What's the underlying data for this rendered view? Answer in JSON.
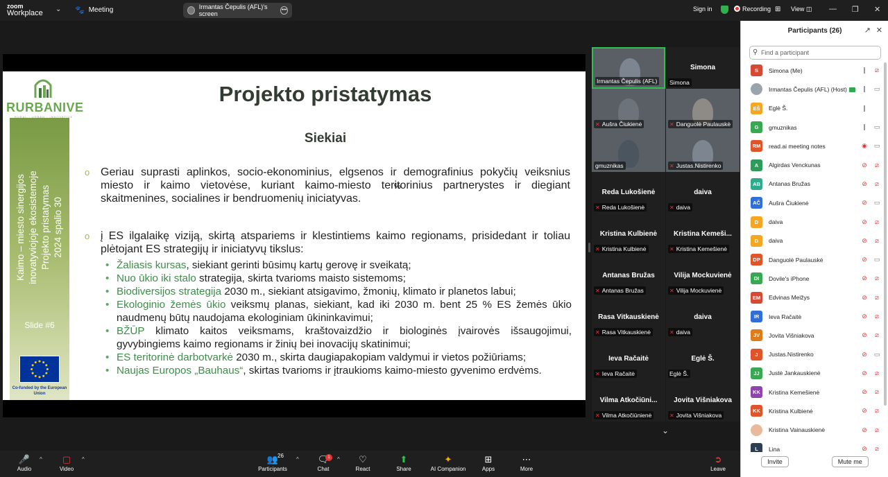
{
  "topbar": {
    "brand_line1": "zoom",
    "brand_line2": "Workplace",
    "meeting_label": "Meeting",
    "screen_share_label": "Irmantas Čepulis (AFL)'s screen",
    "signin": "Sign in",
    "recording": "Recording",
    "view": "View"
  },
  "slide": {
    "title": "Projekto pristatymas",
    "subtitle": "Siekiai",
    "logo_word": "RURBANIVE",
    "logo_tagline": "RURAL · URBAN · INNOVATIVE",
    "sidebar_line1": "Kaimo – miesto sinergijos",
    "sidebar_line2": "inovatyviojoje ekosistemoje",
    "sidebar_line3": "Projekto pristatymas",
    "sidebar_line4": "2024 spalio 30",
    "slide_number": "Slide #6",
    "cofunded": "Co-funded by the European Union",
    "para1": "Geriau suprasti aplinkos, socio-ekonominius, elgsenos ir demografinius pokyčių veiksnius miesto ir kaimo vietovėse, kuriant kaimo-miesto teritorinius partnerystes ir diegiant skaitmenines, socialines ir bendruomenių iniciatyvas.",
    "para2": "į ES ilgalaikę viziją, skirtą atspariems ir klestintiems kaimo regionams, prisidedant ir toliau plėtojant ES strategijų ir iniciatyvų tikslus:",
    "items": [
      {
        "g": "Žaliasis kursas",
        "t": ", siekiant gerinti būsimų kartų gerovę ir sveikatą;"
      },
      {
        "g": "Nuo ūkio iki stalo",
        "t": " strategija, skirta tvarioms maisto sistemoms;"
      },
      {
        "g": "Biodiversijos strategija",
        "t": " 2030 m., siekiant atsigavimo, žmonių, klimato ir planetos labui;"
      },
      {
        "g": "Ekologinio žemės ūkio",
        "t": " veiksmų planas, siekiant, kad iki 2030 m. bent 25 % ES žemės ūkio naudmenų būtų naudojama ekologiniam ūkininkavimui;"
      },
      {
        "g": "BŽŪP",
        "t": " klimato kaitos veiksmams, kraštovaizdžio ir biologinės įvairovės išsaugojimui, gyvybingiems kaimo regionams ir žinių bei inovacijų skatinimui;"
      },
      {
        "g": "ES teritorinė darbotvarkė",
        "t": " 2030 m., skirta daugiapakopiam valdymui ir vietos požiūriams;"
      },
      {
        "g": "Naujas Europos „Bauhaus“",
        "t": ", skirtas tvarioms ir įtraukioms kaimo-miesto gyvenimo erdvėms."
      }
    ]
  },
  "gallery": [
    {
      "label": "Irmantas Čepulis (AFL)",
      "name": "",
      "video": true,
      "active": true,
      "muted": false
    },
    {
      "label": "Simona",
      "name": "Simona",
      "video": false,
      "active": false,
      "muted": false
    },
    {
      "label": "Aušra Čiukienė",
      "name": "",
      "video": true,
      "active": false,
      "muted": true
    },
    {
      "label": "Danguolė Paulauskė",
      "name": "",
      "video": true,
      "active": false,
      "muted": true
    },
    {
      "label": "gmuznikas",
      "name": "",
      "video": true,
      "active": false,
      "muted": false
    },
    {
      "label": "Justas.Nistirenko",
      "name": "",
      "video": true,
      "active": false,
      "muted": true
    },
    {
      "label": "Reda Lukošienė",
      "name": "Reda Lukošienė",
      "video": false,
      "active": false,
      "muted": true
    },
    {
      "label": "daiva",
      "name": "daiva",
      "video": false,
      "active": false,
      "muted": true
    },
    {
      "label": "Kristina Kulbienė",
      "name": "Kristina Kulbienė",
      "video": false,
      "active": false,
      "muted": true
    },
    {
      "label": "Kristina Kemešienė",
      "name": "Kristina Kemeši...",
      "video": false,
      "active": false,
      "muted": true
    },
    {
      "label": "Antanas Bružas",
      "name": "Antanas Bružas",
      "video": false,
      "active": false,
      "muted": true
    },
    {
      "label": "Vilija Mockuvienė",
      "name": "Vilija Mockuvienė",
      "video": false,
      "active": false,
      "muted": true
    },
    {
      "label": "Rasa Vitkauskienė",
      "name": "Rasa Vitkauskienė",
      "video": false,
      "active": false,
      "muted": true
    },
    {
      "label": "daiva",
      "name": "daiva",
      "video": false,
      "active": false,
      "muted": true
    },
    {
      "label": "Ieva Račaitė",
      "name": "Ieva Račaitė",
      "video": false,
      "active": false,
      "muted": true
    },
    {
      "label": "Eglė Š.",
      "name": "Eglė Š.",
      "video": false,
      "active": false,
      "muted": false
    },
    {
      "label": "Vilma Atkočiūnienė",
      "name": "Vilma  Atkočiūni...",
      "video": false,
      "active": false,
      "muted": true
    },
    {
      "label": "Jovita Višniakova",
      "name": "Jovita Višniakova",
      "video": false,
      "active": false,
      "muted": true
    }
  ],
  "participants": {
    "title": "Participants (26)",
    "search_placeholder": "Find a participant",
    "invite": "Invite",
    "mute_me": "Mute me",
    "list": [
      {
        "initials": "S",
        "color": "#d64a35",
        "name": "Simona (Me)",
        "mic": "on",
        "cam": "off"
      },
      {
        "initials": "",
        "color": "#9aa4ad",
        "name": "Irmantas Čepulis (AFL) (Host)",
        "host": true,
        "mic": "on",
        "cam": "on"
      },
      {
        "initials": "EŠ",
        "color": "#f5a623",
        "name": "Eglė Š.",
        "mic": "on",
        "cam": "none"
      },
      {
        "initials": "G",
        "color": "#38a852",
        "name": "gmuznikas",
        "mic": "on",
        "cam": "on"
      },
      {
        "initials": "RM",
        "color": "#e0542a",
        "name": "read.ai meeting notes",
        "mic": "rec",
        "cam": "on"
      },
      {
        "initials": "A",
        "color": "#2e9b5a",
        "name": "Algirdas Venckunas",
        "mic": "off",
        "cam": "off"
      },
      {
        "initials": "AB",
        "color": "#2eaa8c",
        "name": "Antanas Bružas",
        "mic": "off",
        "cam": "off"
      },
      {
        "initials": "AČ",
        "color": "#2f6fd6",
        "name": "Aušra Čiukienė",
        "mic": "off",
        "cam": "on"
      },
      {
        "initials": "D",
        "color": "#f5a623",
        "name": "daiva",
        "mic": "off",
        "cam": "off"
      },
      {
        "initials": "D",
        "color": "#f5a623",
        "name": "daiva",
        "mic": "off",
        "cam": "off"
      },
      {
        "initials": "DP",
        "color": "#e0542a",
        "name": "Danguolė Paulauskė",
        "mic": "off",
        "cam": "on"
      },
      {
        "initials": "DI",
        "color": "#38a852",
        "name": "Dovile's iPhone",
        "mic": "off",
        "cam": "off"
      },
      {
        "initials": "EM",
        "color": "#d64a35",
        "name": "Edvinas Meižys",
        "mic": "off",
        "cam": "off"
      },
      {
        "initials": "IR",
        "color": "#2f6fd6",
        "name": "Ieva Račaitė",
        "mic": "off",
        "cam": "off"
      },
      {
        "initials": "JV",
        "color": "#e07b1a",
        "name": "Jovita Višniakova",
        "mic": "off",
        "cam": "off"
      },
      {
        "initials": "J",
        "color": "#e0542a",
        "name": "Justas.Nistirenko",
        "mic": "off",
        "cam": "on"
      },
      {
        "initials": "JJ",
        "color": "#38a852",
        "name": "Justė Jankauskienė",
        "mic": "off",
        "cam": "off"
      },
      {
        "initials": "KK",
        "color": "#8e44ad",
        "name": "Kristina Kemešienė",
        "mic": "off",
        "cam": "off"
      },
      {
        "initials": "KK",
        "color": "#e0542a",
        "name": "Kristina Kulbienė",
        "mic": "off",
        "cam": "off"
      },
      {
        "initials": "",
        "color": "#e8b99a",
        "name": "Kristina Vainauskienė",
        "mic": "off",
        "cam": "off"
      },
      {
        "initials": "L",
        "color": "#2c3e50",
        "name": "Lina",
        "mic": "off",
        "cam": "off"
      }
    ]
  },
  "toolbar": {
    "audio": "Audio",
    "video": "Video",
    "participants": "Participants",
    "participants_count": "26",
    "chat": "Chat",
    "chat_badge": "1",
    "react": "React",
    "share": "Share",
    "ai": "AI Companion",
    "apps": "Apps",
    "more": "More",
    "leave": "Leave"
  }
}
